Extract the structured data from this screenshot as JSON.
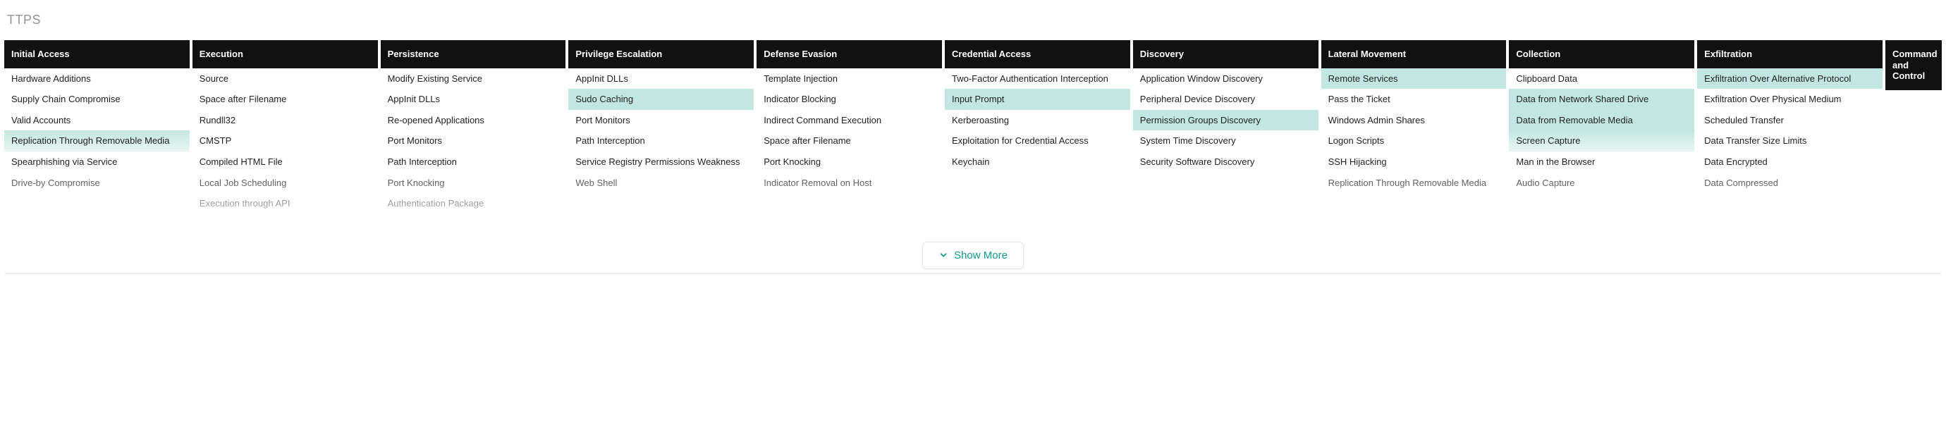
{
  "title": "TTPS",
  "show_more_label": "Show More",
  "columns": [
    {
      "header": "Initial Access",
      "items": [
        {
          "label": "Hardware Additions"
        },
        {
          "label": "Supply Chain Compromise"
        },
        {
          "label": "Valid Accounts"
        },
        {
          "label": "Replication Through Removable Media",
          "hlGrad": true
        },
        {
          "label": "Spearphishing via Service"
        },
        {
          "label": "Drive-by Compromise"
        }
      ]
    },
    {
      "header": "Execution",
      "items": [
        {
          "label": "Source"
        },
        {
          "label": "Space after Filename"
        },
        {
          "label": "Rundll32"
        },
        {
          "label": "CMSTP"
        },
        {
          "label": "Compiled HTML File"
        },
        {
          "label": "Local Job Scheduling"
        },
        {
          "label": "Execution through API"
        }
      ]
    },
    {
      "header": "Persistence",
      "items": [
        {
          "label": "Modify Existing Service"
        },
        {
          "label": "AppInit DLLs"
        },
        {
          "label": "Re-opened Applications"
        },
        {
          "label": "Port Monitors"
        },
        {
          "label": "Path Interception"
        },
        {
          "label": "Port Knocking"
        },
        {
          "label": "Authentication Package"
        }
      ]
    },
    {
      "header": "Privilege Escalation",
      "items": [
        {
          "label": "AppInit DLLs"
        },
        {
          "label": "Sudo Caching",
          "hl": true
        },
        {
          "label": "Port Monitors"
        },
        {
          "label": "Path Interception"
        },
        {
          "label": "Service Registry Permissions Weakness"
        },
        {
          "label": "Web Shell"
        }
      ]
    },
    {
      "header": "Defense Evasion",
      "items": [
        {
          "label": "Template Injection"
        },
        {
          "label": "Indicator Blocking"
        },
        {
          "label": "Indirect Command Execution"
        },
        {
          "label": "Space after Filename"
        },
        {
          "label": "Port Knocking"
        },
        {
          "label": "Indicator Removal on Host"
        }
      ]
    },
    {
      "header": "Credential Access",
      "items": [
        {
          "label": "Two-Factor Authentication Interception"
        },
        {
          "label": "Input Prompt",
          "hl": true
        },
        {
          "label": "Kerberoasting"
        },
        {
          "label": "Exploitation for Credential Access"
        },
        {
          "label": "Keychain"
        }
      ]
    },
    {
      "header": "Discovery",
      "items": [
        {
          "label": "Application Window Discovery"
        },
        {
          "label": "Peripheral Device Discovery"
        },
        {
          "label": "Permission Groups Discovery",
          "hl": true
        },
        {
          "label": "System Time Discovery"
        },
        {
          "label": "Security Software Discovery"
        }
      ]
    },
    {
      "header": "Lateral Movement",
      "items": [
        {
          "label": "Remote Services",
          "hl": true
        },
        {
          "label": "Pass the Ticket"
        },
        {
          "label": "Windows Admin Shares"
        },
        {
          "label": "Logon Scripts"
        },
        {
          "label": "SSH Hijacking"
        },
        {
          "label": "Replication Through Removable Media"
        }
      ]
    },
    {
      "header": "Collection",
      "items": [
        {
          "label": "Clipboard Data"
        },
        {
          "label": "Data from Network Shared Drive",
          "hl": true
        },
        {
          "label": "Data from Removable Media",
          "hl": true
        },
        {
          "label": "Screen Capture",
          "hlGrad": true
        },
        {
          "label": "Man in the Browser"
        },
        {
          "label": "Audio Capture"
        }
      ]
    },
    {
      "header": "Exfiltration",
      "items": [
        {
          "label": "Exfiltration Over Alternative Protocol",
          "hl": true
        },
        {
          "label": "Exfiltration Over Physical Medium"
        },
        {
          "label": "Scheduled Transfer"
        },
        {
          "label": "Data Transfer Size Limits"
        },
        {
          "label": "Data Encrypted"
        },
        {
          "label": "Data Compressed"
        }
      ]
    },
    {
      "header": "Command and Control",
      "narrow": true,
      "items": []
    }
  ]
}
